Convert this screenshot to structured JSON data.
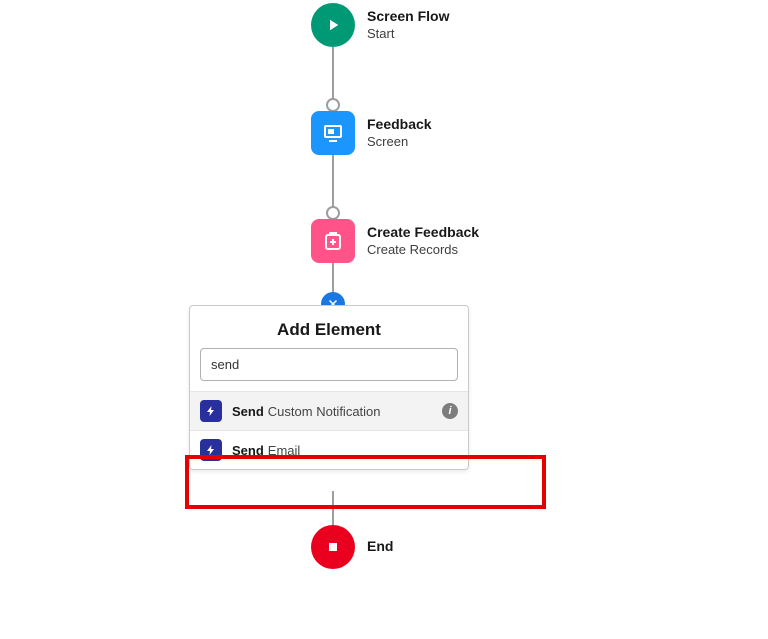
{
  "nodes": {
    "start": {
      "title": "Screen Flow",
      "subtitle": "Start"
    },
    "feedback": {
      "title": "Feedback",
      "subtitle": "Screen"
    },
    "create": {
      "title": "Create Feedback",
      "subtitle": "Create Records"
    },
    "end": {
      "title": "End"
    }
  },
  "panel": {
    "title": "Add Element",
    "search_value": "send",
    "results": [
      {
        "name": "Send",
        "sub": "Custom Notification"
      },
      {
        "name": "Send",
        "sub": "Email"
      }
    ]
  }
}
